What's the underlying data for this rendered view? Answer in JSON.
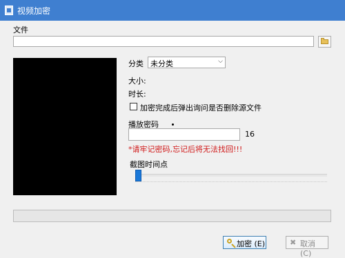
{
  "window": {
    "title": "视频加密"
  },
  "file": {
    "label": "文件",
    "value": ""
  },
  "category": {
    "label": "分类",
    "selected": "未分类"
  },
  "info": {
    "size_label": "大小:",
    "duration_label": "时长:"
  },
  "options": {
    "ask_delete_source": "加密完成后弹出询问是否删除源文件"
  },
  "password": {
    "label": "播放密码",
    "max_length": "16",
    "value": ""
  },
  "warning": "*请牢记密码,忘记后将无法找回!!!",
  "screenshot": {
    "label": "截图时间点",
    "position": 0
  },
  "buttons": {
    "encrypt": "加密 (E)",
    "cancel": "取消 (C)"
  }
}
